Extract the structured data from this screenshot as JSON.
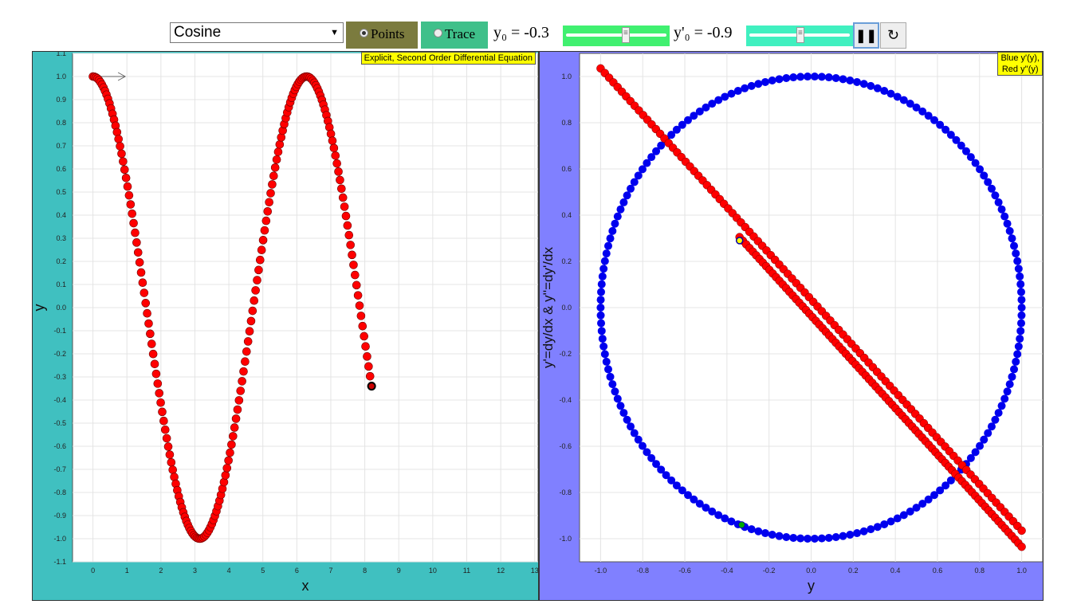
{
  "toolbar": {
    "function_select": {
      "value": "Cosine"
    },
    "points_label": "Points",
    "trace_label": "Trace",
    "y0_label": "y₀ = -0.3",
    "yp0_label": "y'₀ = -0.9",
    "y0_slider_value": -0.3,
    "yp0_slider_value": -0.9,
    "pause_label": "❚❚",
    "reset_label": "↻",
    "colors": {
      "points_bg": "#7b7b3e",
      "trace_bg": "#3fc08a",
      "y0_slider": "#40f070",
      "yp0_slider": "#40f0c0"
    },
    "icons": [
      "pause-icon",
      "reset-icon"
    ]
  },
  "left_badge": "Explicit, Second Order Differential Equation",
  "right_badge_lines": [
    "Blue y'(y),",
    "Red y''(y)"
  ],
  "chart_data": [
    {
      "type": "scatter",
      "xlabel": "x",
      "ylabel": "y",
      "xlim": [
        -0.6,
        13.1
      ],
      "ylim": [
        -1.1,
        1.1
      ],
      "x_ticks": [
        0,
        1,
        2,
        3,
        4,
        5,
        6,
        7,
        8,
        9,
        10,
        11,
        12,
        13
      ],
      "y_ticks": [
        1.1,
        1.0,
        0.9,
        0.8,
        0.7,
        0.6,
        0.5,
        0.4,
        0.3,
        0.2,
        0.1,
        0.0,
        -0.1,
        -0.2,
        -0.3,
        -0.4,
        -0.5,
        -0.6,
        -0.7,
        -0.8,
        -0.9,
        -1.0,
        -1.1
      ],
      "series": [
        {
          "function": "cos",
          "x_start": 0,
          "x_end": 8.2,
          "n_points": 186,
          "color": "#ff0000",
          "last_point": [
            8.2,
            -0.34
          ]
        }
      ],
      "background": "#40c0c0",
      "grid": true
    },
    {
      "type": "scatter",
      "xlabel": "y",
      "ylabel": "y'=dy/dx & y''=dy'/dx",
      "xlim": [
        -1.1,
        1.1
      ],
      "ylim": [
        -1.1,
        1.1
      ],
      "x_ticks": [
        -1.0,
        -0.8,
        -0.6,
        -0.4,
        -0.2,
        0.0,
        0.2,
        0.4,
        0.6,
        0.8,
        1.0
      ],
      "y_ticks": [
        1.0,
        0.8,
        0.6,
        0.4,
        0.2,
        0.0,
        -0.2,
        -0.4,
        -0.6,
        -0.8,
        -1.0
      ],
      "series": [
        {
          "relation": "y' vs y",
          "color": "#0000ee",
          "shape": "circle"
        },
        {
          "relation": "y'' vs y",
          "color": "#ff0000",
          "shape": "line"
        }
      ],
      "current_point": [
        -0.34,
        0.29
      ],
      "background": "#8080ff",
      "grid": true
    }
  ]
}
